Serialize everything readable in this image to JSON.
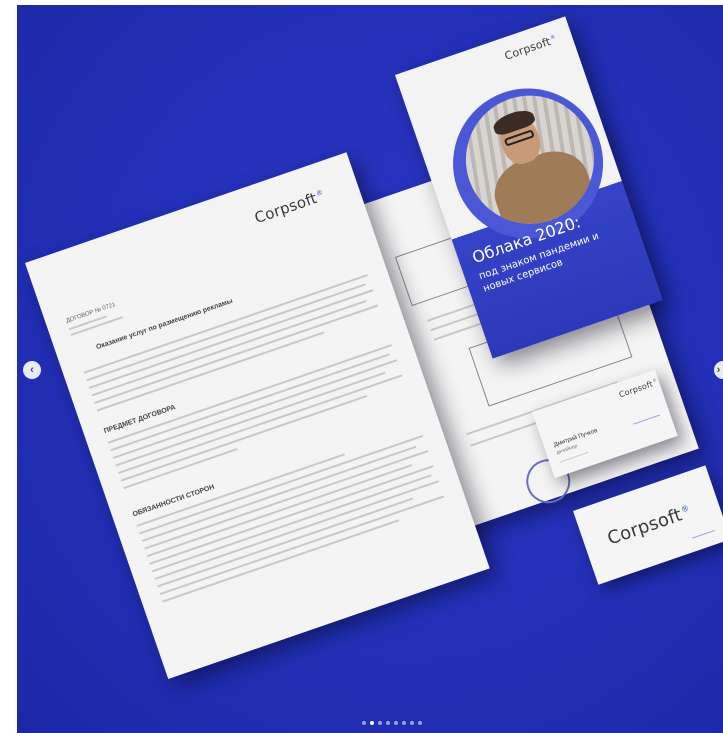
{
  "carousel": {
    "prev_icon": "chevron-left-icon",
    "next_icon": "chevron-right-icon",
    "prev_glyph": "‹",
    "next_glyph": "›",
    "slide_count": 8,
    "active_index": 1
  },
  "colors": {
    "background": "#2230b8",
    "accent": "#3b4fd6",
    "paper": "#f4f4f4"
  },
  "brand": {
    "name": "Corpsoft",
    "mark": "®"
  },
  "letter": {
    "doc_number": "ДОГОВОР № 0721",
    "heading": "Оказание услуг по размещению рекламы",
    "section_subject": "ПРЕДМЕТ ДОГОВОРА",
    "section_duties": "ОБЯЗАННОСТИ СТОРОН"
  },
  "brochure": {
    "title": "Облака 2020:",
    "subtitle": "под знаком пандемии и новых сервисов"
  },
  "business_card": {
    "person_name": "Дмитрий Пучков",
    "person_role": "дизайнер"
  }
}
